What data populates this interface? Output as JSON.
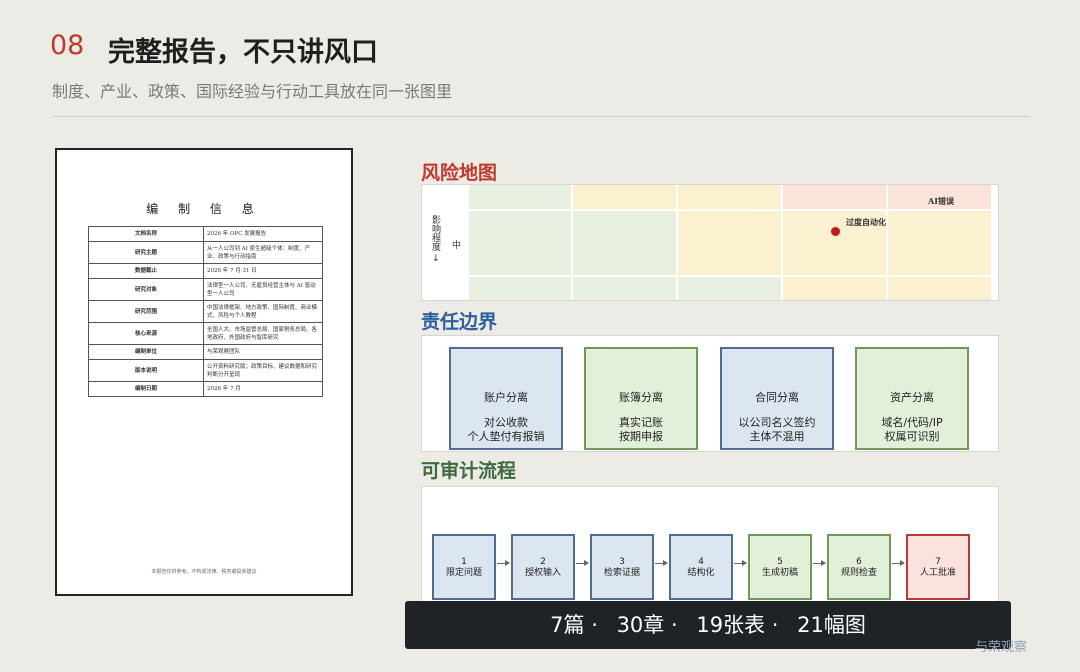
{
  "header": {
    "number": "08",
    "title": "完整报告，不只讲风口",
    "subtitle": "制度、产业、政策、国际经验与行动工具放在同一张图里"
  },
  "document": {
    "heading": "编 制 信 息",
    "rows": [
      {
        "key": "文档名称",
        "value": "2026 年 OPC 发展报告"
      },
      {
        "key": "研究主题",
        "value": "从一人公司到 AI 原生超级个体：制度、产业、政策与行动指南"
      },
      {
        "key": "数据截止",
        "value": "2026 年 7 月 31 日"
      },
      {
        "key": "研究对象",
        "value": "法律型一人公司、无雇员经营主体与 AI 驱动型一人公司"
      },
      {
        "key": "研究范围",
        "value": "中国法律框架、地方政策、国际制度、商业模式、风险与个人教程"
      },
      {
        "key": "核心来源",
        "value": "全国人大、市场监管总局、国家税务总局、各地政府、外国政府与智库研究"
      },
      {
        "key": "编制单位",
        "value": "与荣观察团队"
      },
      {
        "key": "版本说明",
        "value": "公开资料研究版；政策目标、建议数据和研究判断分开呈现"
      },
      {
        "key": "编制日期",
        "value": "2026 年 7 月"
      }
    ],
    "footer": "本报告仅供参考，不构成法律、税务或投资建议"
  },
  "risk_map": {
    "title": "风险地图",
    "axis_label": "影响程度 →",
    "axis_mid": "中",
    "point_label": "过度自动化",
    "cell_label": "AI错误",
    "colors": {
      "green": "#e8f1e1",
      "yellow": "#fbf0cf",
      "orange": "#fbe3d9",
      "red_point": "#c0181e"
    }
  },
  "responsibility": {
    "title": "责任边界",
    "cards": [
      {
        "title": "账户分离",
        "line1": "对公收款",
        "line2": "个人垫付有报销",
        "color": "blue"
      },
      {
        "title": "账簿分离",
        "line1": "真实记账",
        "line2": "按期申报",
        "color": "green"
      },
      {
        "title": "合同分离",
        "line1": "以公司名义签约",
        "line2": "主体不混用",
        "color": "blue"
      },
      {
        "title": "资产分离",
        "line1": "域名/代码/IP",
        "line2": "权属可识别",
        "color": "green"
      }
    ]
  },
  "audit": {
    "title": "可审计流程",
    "steps": [
      {
        "num": "1",
        "label": "限定问题",
        "color": "blue"
      },
      {
        "num": "2",
        "label": "授权输入",
        "color": "blue"
      },
      {
        "num": "3",
        "label": "检索证据",
        "color": "blue"
      },
      {
        "num": "4",
        "label": "结构化",
        "color": "blue"
      },
      {
        "num": "5",
        "label": "生成初稿",
        "color": "green"
      },
      {
        "num": "6",
        "label": "规则检查",
        "color": "green"
      },
      {
        "num": "7",
        "label": "人工批准",
        "color": "red"
      }
    ]
  },
  "stats": {
    "items": [
      "7篇 ·",
      "30章 ·",
      "19张表 ·",
      "21幅图"
    ]
  },
  "watermark": "与荣观察"
}
